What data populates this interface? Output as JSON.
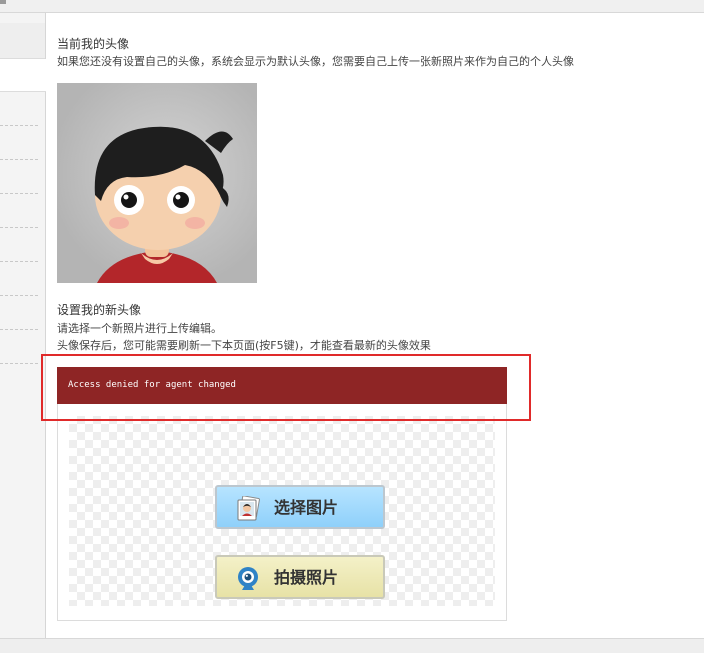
{
  "current_avatar": {
    "heading": "当前我的头像",
    "description": "如果您还没有设置自己的头像，系统会显示为默认头像，您需要自己上传一张新照片来作为自己的个人头像"
  },
  "new_avatar": {
    "heading": "设置我的新头像",
    "instruction": "请选择一个新照片进行上传编辑。",
    "note": "头像保存后，您可能需要刷新一下本页面(按F5键)，才能查看最新的头像效果"
  },
  "uploader": {
    "error_message": "Access denied for agent changed",
    "select_button_label": "选择图片",
    "camera_button_label": "拍摄照片",
    "select_icon": "photo-stack-icon",
    "camera_icon": "webcam-icon"
  },
  "colors": {
    "error_bar": "#8e2525",
    "highlight_border": "#e02a2a",
    "select_button": "#a3dafd",
    "camera_button": "#ede9b7"
  }
}
